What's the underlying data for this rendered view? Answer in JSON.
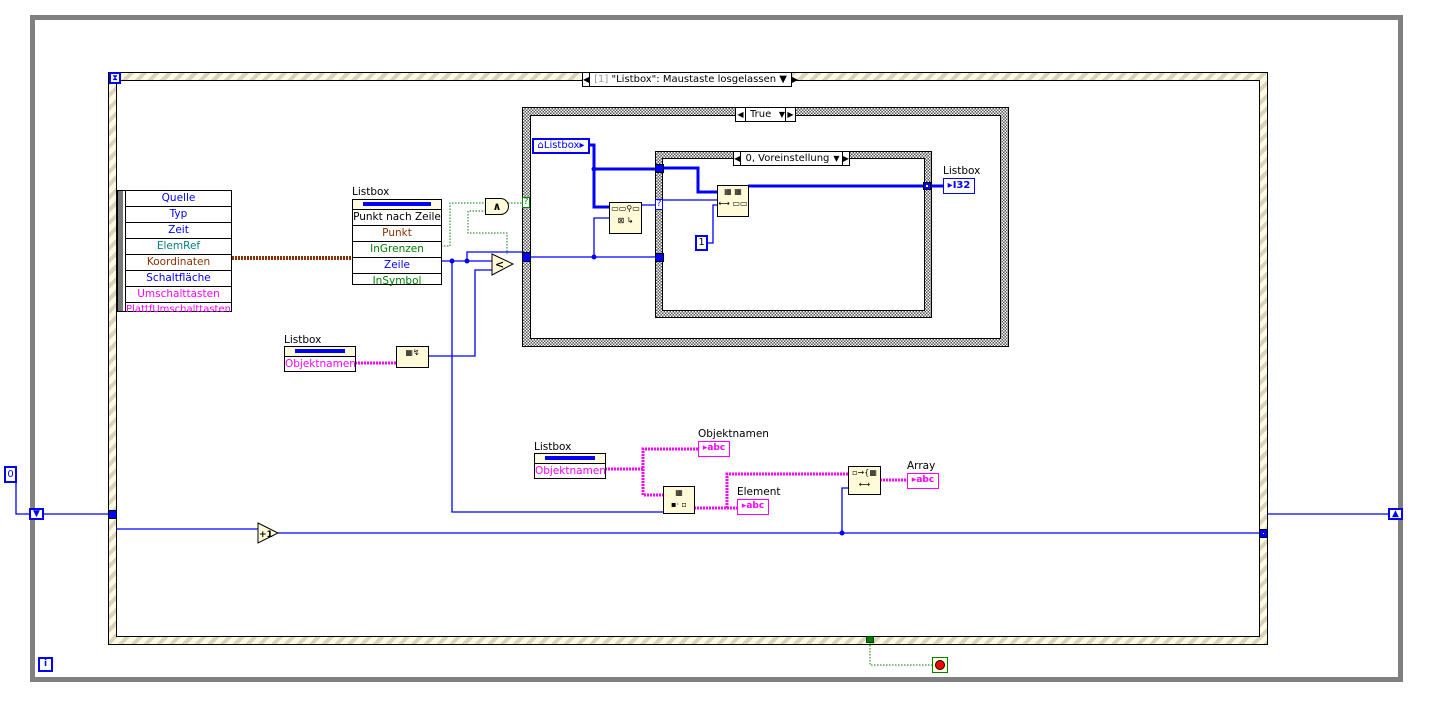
{
  "event_structure": {
    "selector": "[1] \"Listbox\": Maustaste losgelassen",
    "selector_index": "[1]",
    "selector_event": "\"Listbox\": Maustaste losgelassen"
  },
  "event_data_node": {
    "items": [
      {
        "label": "Quelle",
        "color": "#0000ff"
      },
      {
        "label": "Typ",
        "color": "#0000ff"
      },
      {
        "label": "Zeit",
        "color": "#0000ff"
      },
      {
        "label": "ElemRef",
        "color": "#008080"
      },
      {
        "label": "Koordinaten",
        "color": "#8b3000"
      },
      {
        "label": "Schaltfläche",
        "color": "#0000ff"
      },
      {
        "label": "Umschalttasten",
        "color": "#ff00ff"
      },
      {
        "label": "PlattfUmschalttasten",
        "color": "#ff00ff"
      }
    ]
  },
  "property_node_1": {
    "label": "Listbox",
    "method": "Punkt nach Zeile",
    "items": [
      {
        "label": "Punkt",
        "color": "#8b3000"
      },
      {
        "label": "InGrenzen",
        "color": "#008000"
      },
      {
        "label": "Zeile",
        "color": "#0000ff"
      },
      {
        "label": "InSymbol",
        "color": "#008000"
      }
    ]
  },
  "property_node_2": {
    "label": "Listbox",
    "item": "Objektnamen"
  },
  "property_node_3": {
    "label": "Listbox",
    "item": "Objektnamen"
  },
  "case_outer": {
    "selector": "True"
  },
  "case_inner": {
    "selector": "0, Voreinstellung"
  },
  "listbox_ref": {
    "label": "Listbox"
  },
  "constant_one": "1",
  "constant_zero": "0",
  "increment": "+1",
  "and_gate": "∧",
  "less_than": "<",
  "indicators": {
    "listbox": {
      "label": "Listbox",
      "type": "I32"
    },
    "objektnamen": {
      "label": "Objektnamen",
      "type": "abc"
    },
    "element": {
      "label": "Element",
      "type": "abc"
    },
    "array": {
      "label": "Array",
      "type": "abc"
    }
  },
  "iteration_terminal": "i",
  "wire_colors": {
    "integer": "#0000ff",
    "string": "#ff00ff",
    "boolean": "#008000",
    "cluster": "#8b3000"
  }
}
